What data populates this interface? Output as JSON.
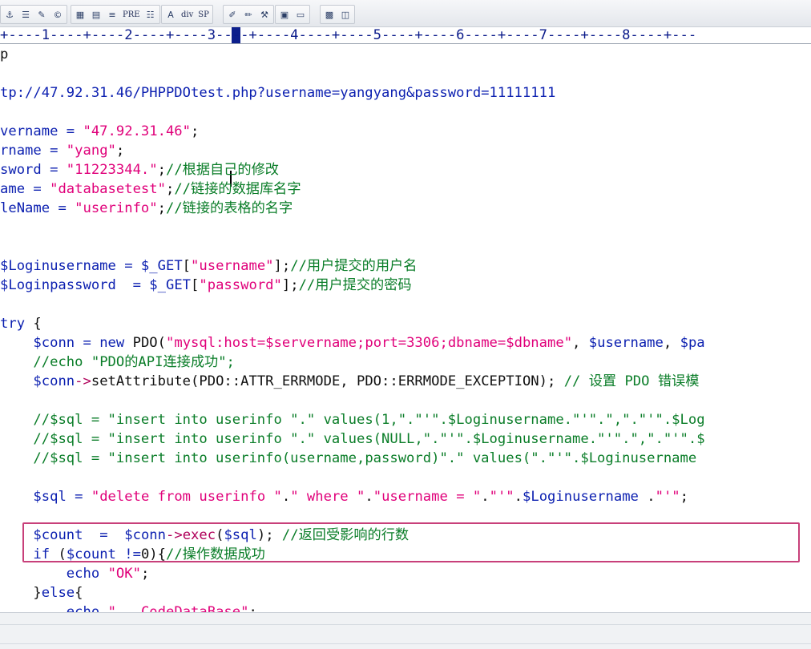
{
  "toolbar": {
    "groups": [
      [
        {
          "name": "anchor-icon",
          "glyph": "⚓"
        },
        {
          "name": "paragraph-icon",
          "glyph": "☰"
        },
        {
          "name": "pencil-icon",
          "glyph": "✎"
        },
        {
          "name": "copyright-icon",
          "glyph": "©"
        }
      ],
      [
        {
          "name": "table-icon",
          "glyph": "▦"
        },
        {
          "name": "form-icon",
          "glyph": "▤"
        },
        {
          "name": "align-icon",
          "glyph": "≡"
        },
        {
          "name": "pre-button",
          "glyph": "PRE"
        },
        {
          "name": "list-icon",
          "glyph": "☷"
        }
      ],
      [
        {
          "name": "font-icon",
          "glyph": "A"
        },
        {
          "name": "div-button",
          "glyph": "div"
        },
        {
          "name": "sp-button",
          "glyph": "SP"
        }
      ],
      [
        {
          "name": "edit-icon",
          "glyph": "✐"
        },
        {
          "name": "brush-icon",
          "glyph": "✏"
        },
        {
          "name": "tools-icon",
          "glyph": "⚒"
        }
      ],
      [
        {
          "name": "frame-icon",
          "glyph": "▣"
        },
        {
          "name": "window-icon",
          "glyph": "▭"
        }
      ],
      [
        {
          "name": "grid-icon",
          "glyph": "▩"
        },
        {
          "name": "panel-icon",
          "glyph": "◫"
        }
      ]
    ]
  },
  "ruler": {
    "text": "+----1----+----2----+----3----+----4----+----5----+----6----+----7----+----8----+---"
  },
  "editor": {
    "lines": [
      [
        {
          "c": "plain",
          "t": "p"
        }
      ],
      [],
      [
        {
          "c": "var",
          "t": "tp://47.92.31.46/PHPPDOtest.php?username=yangyang&password=11111111"
        }
      ],
      [],
      [
        {
          "c": "var",
          "t": "vername"
        },
        {
          "c": "op",
          "t": " = "
        },
        {
          "c": "str",
          "t": "\"47.92.31.46\""
        },
        {
          "c": "plain",
          "t": ";"
        }
      ],
      [
        {
          "c": "var",
          "t": "rname"
        },
        {
          "c": "op",
          "t": " = "
        },
        {
          "c": "str",
          "t": "\"yang\""
        },
        {
          "c": "plain",
          "t": ";"
        }
      ],
      [
        {
          "c": "var",
          "t": "sword"
        },
        {
          "c": "op",
          "t": " = "
        },
        {
          "c": "str",
          "t": "\"11223344.\""
        },
        {
          "c": "plain",
          "t": ";"
        },
        {
          "c": "cmt",
          "t": "//根据自己的修改"
        }
      ],
      [
        {
          "c": "var",
          "t": "ame"
        },
        {
          "c": "op",
          "t": " = "
        },
        {
          "c": "str",
          "t": "\"databasetest\""
        },
        {
          "c": "plain",
          "t": ";"
        },
        {
          "c": "cmt",
          "t": "//链接的数据库名字"
        }
      ],
      [
        {
          "c": "var",
          "t": "leName"
        },
        {
          "c": "op",
          "t": " = "
        },
        {
          "c": "str",
          "t": "\"userinfo\""
        },
        {
          "c": "plain",
          "t": ";"
        },
        {
          "c": "cmt",
          "t": "//链接的表格的名字"
        }
      ],
      [],
      [],
      [
        {
          "c": "var",
          "t": "$Loginusername"
        },
        {
          "c": "op",
          "t": " = "
        },
        {
          "c": "var",
          "t": "$_GET"
        },
        {
          "c": "plain",
          "t": "["
        },
        {
          "c": "str",
          "t": "\"username\""
        },
        {
          "c": "plain",
          "t": "];"
        },
        {
          "c": "cmt",
          "t": "//用户提交的用户名"
        }
      ],
      [
        {
          "c": "var",
          "t": "$Loginpassword"
        },
        {
          "c": "op",
          "t": "  = "
        },
        {
          "c": "var",
          "t": "$_GET"
        },
        {
          "c": "plain",
          "t": "["
        },
        {
          "c": "str",
          "t": "\"password\""
        },
        {
          "c": "plain",
          "t": "];"
        },
        {
          "c": "cmt",
          "t": "//用户提交的密码"
        }
      ],
      [],
      [
        {
          "c": "kw",
          "t": "try"
        },
        {
          "c": "plain",
          "t": " {"
        }
      ],
      [
        {
          "c": "plain",
          "t": "    "
        },
        {
          "c": "var",
          "t": "$conn"
        },
        {
          "c": "op",
          "t": " = "
        },
        {
          "c": "kw",
          "t": "new"
        },
        {
          "c": "plain",
          "t": " PDO("
        },
        {
          "c": "str",
          "t": "\"mysql:host=$servername;port=3306;dbname=$dbname\""
        },
        {
          "c": "plain",
          "t": ", "
        },
        {
          "c": "var",
          "t": "$username"
        },
        {
          "c": "plain",
          "t": ", "
        },
        {
          "c": "var",
          "t": "$pa"
        }
      ],
      [
        {
          "c": "plain",
          "t": "    "
        },
        {
          "c": "cmt",
          "t": "//echo \"PDO的API连接成功\";"
        }
      ],
      [
        {
          "c": "plain",
          "t": "    "
        },
        {
          "c": "var",
          "t": "$conn"
        },
        {
          "c": "fn",
          "t": "->"
        },
        {
          "c": "plain",
          "t": "setAttribute(PDO::ATTR_ERRMODE, PDO::ERRMODE_EXCEPTION); "
        },
        {
          "c": "cmt",
          "t": "// 设置 PDO 错误模"
        }
      ],
      [],
      [
        {
          "c": "plain",
          "t": "    "
        },
        {
          "c": "cmt",
          "t": "//$sql = \"insert into userinfo \".\" values(1,\".\"'\".$Loginusername.\"'\".\",\".\"'\".$Log"
        }
      ],
      [
        {
          "c": "plain",
          "t": "    "
        },
        {
          "c": "cmt",
          "t": "//$sql = \"insert into userinfo \".\" values(NULL,\".\"'\".$Loginusername.\"'\".\",\".\"'\".$"
        }
      ],
      [
        {
          "c": "plain",
          "t": "    "
        },
        {
          "c": "cmt",
          "t": "//$sql = \"insert into userinfo(username,password)\".\" values(\".\"'\".$Loginusername"
        }
      ],
      [],
      [
        {
          "c": "plain",
          "t": "    "
        },
        {
          "c": "var",
          "t": "$sql"
        },
        {
          "c": "op",
          "t": " = "
        },
        {
          "c": "str",
          "t": "\"delete from userinfo \""
        },
        {
          "c": "plain",
          "t": "."
        },
        {
          "c": "str",
          "t": "\" where \""
        },
        {
          "c": "plain",
          "t": "."
        },
        {
          "c": "str",
          "t": "\"username = \""
        },
        {
          "c": "plain",
          "t": "."
        },
        {
          "c": "str",
          "t": "\"'\""
        },
        {
          "c": "plain",
          "t": "."
        },
        {
          "c": "var",
          "t": "$Loginusername"
        },
        {
          "c": "plain",
          "t": " ."
        },
        {
          "c": "str",
          "t": "\"'\""
        },
        {
          "c": "plain",
          "t": ";"
        }
      ],
      [],
      [
        {
          "c": "plain",
          "t": "    "
        },
        {
          "c": "var",
          "t": "$count"
        },
        {
          "c": "op",
          "t": "  =  "
        },
        {
          "c": "var",
          "t": "$conn"
        },
        {
          "c": "fn",
          "t": "->exec"
        },
        {
          "c": "plain",
          "t": "("
        },
        {
          "c": "var",
          "t": "$sql"
        },
        {
          "c": "plain",
          "t": "); "
        },
        {
          "c": "cmt",
          "t": "//返回受影响的行数"
        }
      ],
      [
        {
          "c": "plain",
          "t": "    "
        },
        {
          "c": "kw",
          "t": "if"
        },
        {
          "c": "plain",
          "t": " ("
        },
        {
          "c": "var",
          "t": "$count"
        },
        {
          "c": "op",
          "t": " !="
        },
        {
          "c": "plain",
          "t": "0){"
        },
        {
          "c": "cmt",
          "t": "//操作数据成功"
        }
      ],
      [
        {
          "c": "plain",
          "t": "        "
        },
        {
          "c": "kw",
          "t": "echo"
        },
        {
          "c": "plain",
          "t": " "
        },
        {
          "c": "str",
          "t": "\"OK\""
        },
        {
          "c": "plain",
          "t": ";"
        }
      ],
      [
        {
          "c": "plain",
          "t": "    }"
        },
        {
          "c": "kw",
          "t": "else"
        },
        {
          "c": "plain",
          "t": "{"
        }
      ],
      [
        {
          "c": "plain",
          "t": "        "
        },
        {
          "c": "kw",
          "t": "echo"
        },
        {
          "c": "plain",
          "t": " "
        },
        {
          "c": "str",
          "t": "\"...CodeDataBase\""
        },
        {
          "c": "plain",
          "t": ";"
        }
      ]
    ]
  },
  "colors": {
    "string": "#e0007a",
    "comment": "#0a7d28",
    "variable": "#0b1fb0",
    "highlight_border": "#c8407a"
  }
}
